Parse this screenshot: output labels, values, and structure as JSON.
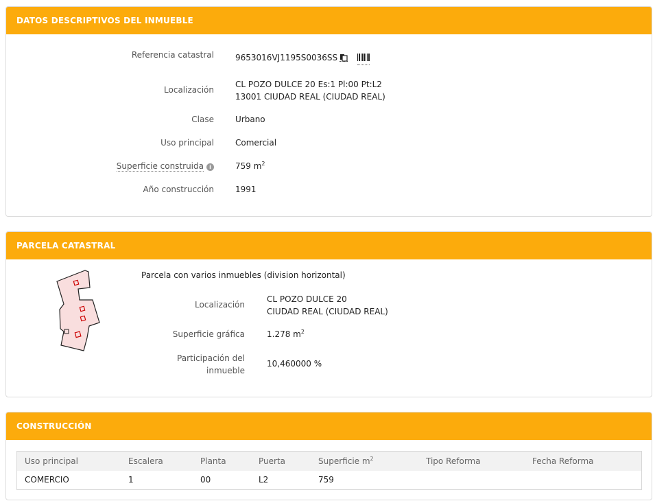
{
  "datos": {
    "header": "DATOS DESCRIPTIVOS DEL INMUEBLE",
    "referencia_label": "Referencia catastral",
    "referencia_value": "9653016VJ1195S0036SS",
    "localizacion_label": "Localización",
    "localizacion_line1": "CL POZO DULCE 20 Es:1 Pl:00 Pt:L2",
    "localizacion_line2": "13001 CIUDAD REAL (CIUDAD REAL)",
    "clase_label": "Clase",
    "clase_value": "Urbano",
    "uso_label": "Uso principal",
    "uso_value": "Comercial",
    "superficie_label": "Superficie construida",
    "superficie_value": "759 m",
    "superficie_sup": "2",
    "anio_label": "Año construcción",
    "anio_value": "1991"
  },
  "parcela": {
    "header": "PARCELA CATASTRAL",
    "descripcion": "Parcela con varios inmuebles (division horizontal)",
    "localizacion_label": "Localización",
    "localizacion_line1": "CL POZO DULCE 20",
    "localizacion_line2": "CIUDAD REAL (CIUDAD REAL)",
    "superficie_label": "Superficie gráfica",
    "superficie_value": "1.278 m",
    "superficie_sup": "2",
    "participacion_label_1": "Participación del",
    "participacion_label_2": "inmueble",
    "participacion_value": "10,460000 %"
  },
  "construccion": {
    "header": "CONSTRUCCIÓN",
    "columns": [
      "Uso principal",
      "Escalera",
      "Planta",
      "Puerta",
      "Superficie m",
      "Tipo Reforma",
      "Fecha Reforma"
    ],
    "superficie_sup": "2",
    "rows": [
      [
        "COMERCIO",
        "1",
        "00",
        "L2",
        "759",
        "",
        ""
      ]
    ]
  },
  "colors": {
    "header_bg": "#fcab0c",
    "parcel_fill": "#f9dede",
    "parcel_marker": "#cc0000"
  },
  "icons": [
    "copy-icon",
    "barcode-icon",
    "info-icon"
  ]
}
